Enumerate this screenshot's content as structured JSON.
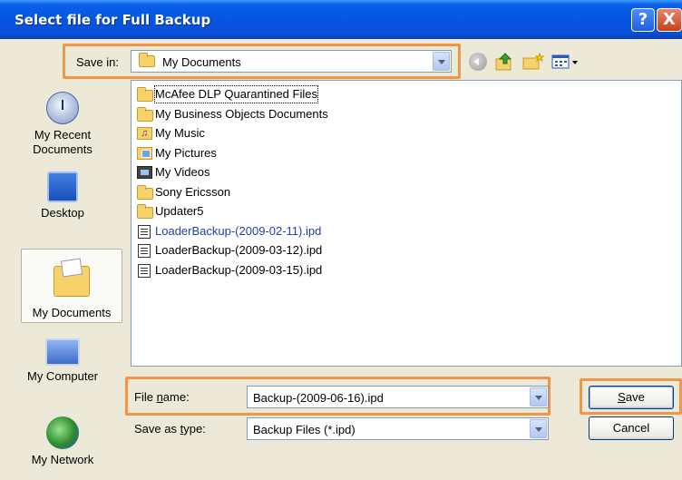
{
  "window": {
    "title": "Select file for Full Backup",
    "help_glyph": "?",
    "close_glyph": "X"
  },
  "save_in": {
    "label": "Save in:",
    "value": "My Documents"
  },
  "places": [
    {
      "label_line1": "My Recent",
      "label_line2": "Documents",
      "icon": "recent-documents-icon"
    },
    {
      "label_line1": "Desktop",
      "label_line2": "",
      "icon": "desktop-icon"
    },
    {
      "label_line1": "My Documents",
      "label_line2": "",
      "icon": "my-documents-icon"
    },
    {
      "label_line1": "My Computer",
      "label_line2": "",
      "icon": "my-computer-icon"
    },
    {
      "label_line1": "My Network",
      "label_line2": "",
      "icon": "my-network-icon"
    }
  ],
  "files": [
    {
      "name": "McAfee DLP Quarantined Files",
      "icon": "folder-icon"
    },
    {
      "name": "My Business Objects Documents",
      "icon": "folder-icon"
    },
    {
      "name": "My Music",
      "icon": "music-folder-icon"
    },
    {
      "name": "My Pictures",
      "icon": "pictures-folder-icon"
    },
    {
      "name": "My Videos",
      "icon": "videos-folder-icon"
    },
    {
      "name": "Sony Ericsson",
      "icon": "folder-icon"
    },
    {
      "name": "Updater5",
      "icon": "folder-icon"
    },
    {
      "name": "LoaderBackup-(2009-02-11).ipd",
      "icon": "ipd-file-icon"
    },
    {
      "name": "LoaderBackup-(2009-03-12).ipd",
      "icon": "ipd-file-icon"
    },
    {
      "name": "LoaderBackup-(2009-03-15).ipd",
      "icon": "ipd-file-icon"
    }
  ],
  "file_name": {
    "label_pre": "File ",
    "label_ul": "n",
    "label_post": "ame:",
    "value": "Backup-(2009-06-16).ipd"
  },
  "save_as_type": {
    "label_pre": "Save as ",
    "label_ul": "t",
    "label_post": "ype:",
    "value": "Backup Files (*.ipd)"
  },
  "buttons": {
    "save_ul": "S",
    "save_rest": "ave",
    "cancel": "Cancel"
  }
}
